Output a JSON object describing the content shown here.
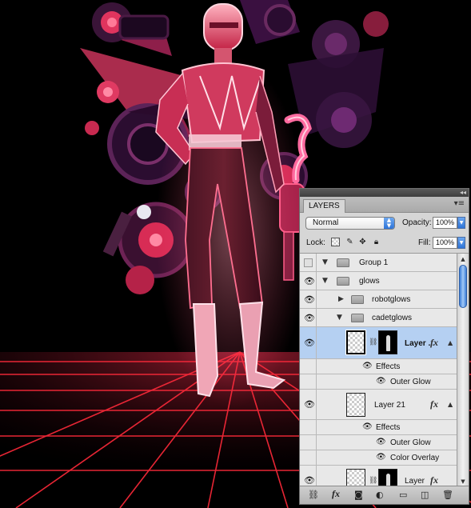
{
  "panel": {
    "tab_label": "LAYERS",
    "collapse_glyph": "◂◂",
    "menu_glyph": "▾≡",
    "blend_mode": "Normal",
    "opacity_label": "Opacity:",
    "opacity_value": "100%",
    "lock_label": "Lock:",
    "fill_label": "Fill:",
    "fill_value": "100%"
  },
  "layers": [
    {
      "name": "Group 1",
      "type": "group",
      "visible": false
    },
    {
      "name": "glows",
      "type": "group",
      "visible": true
    },
    {
      "name": "robotglows",
      "type": "group",
      "visible": true
    },
    {
      "name": "cadetglows",
      "type": "group",
      "visible": true
    },
    {
      "name": "Layer ...",
      "type": "layer",
      "visible": true,
      "selected": true,
      "has_fx": true,
      "effects_label": "Effects",
      "effects": [
        "Outer Glow"
      ]
    },
    {
      "name": "Layer 21",
      "type": "layer",
      "visible": true,
      "has_fx": true,
      "effects_label": "Effects",
      "effects": [
        "Outer Glow",
        "Color Overlay"
      ]
    },
    {
      "name": "Layer",
      "type": "layer",
      "visible": true,
      "has_fx": true
    }
  ],
  "fx_label": "fx",
  "colors": {
    "panel_bg": "#d6d6d6",
    "selected_row": "#b5d0f2",
    "accent_blue": "#2e74d8",
    "neon_pink": "#ff3d6e",
    "grid_red": "#ff2a3a",
    "background": "#000000"
  },
  "icons": [
    "eye-icon",
    "folder-icon",
    "link-icon",
    "fx-icon",
    "mask-icon",
    "adjustment-icon",
    "new-group-icon",
    "new-layer-icon",
    "trash-icon",
    "lock-icon",
    "move-icon",
    "brush-icon"
  ]
}
